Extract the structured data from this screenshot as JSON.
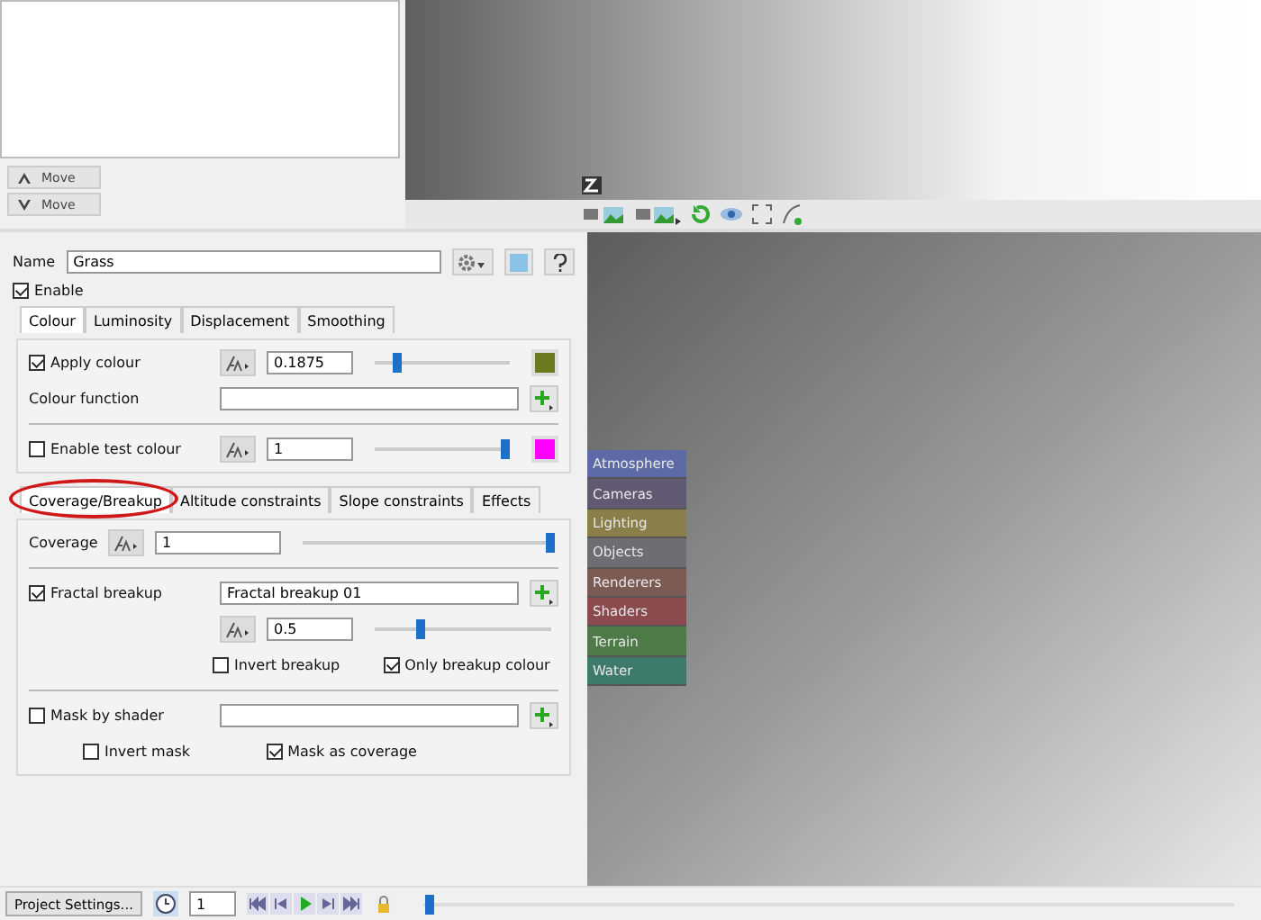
{
  "move_buttons": [
    {
      "label": "Move",
      "kind": "up"
    },
    {
      "label": "Move",
      "kind": "down"
    }
  ],
  "node_palette": [
    {
      "label": "Atmosphere",
      "color": "#5d6aa6"
    },
    {
      "label": "Cameras",
      "color": "#5f5a72"
    },
    {
      "label": "Lighting",
      "color": "#8a7e4a"
    },
    {
      "label": "Objects",
      "color": "#6e6e72"
    },
    {
      "label": "Renderers",
      "color": "#7a5a52"
    },
    {
      "label": "Shaders",
      "color": "#8a4a4e"
    },
    {
      "label": "Terrain",
      "color": "#4e7a48"
    },
    {
      "label": "Water",
      "color": "#3e7a6a"
    }
  ],
  "name_field": {
    "label": "Name",
    "value": "Grass"
  },
  "enable": {
    "label": "Enable",
    "checked": true
  },
  "colour_tabs": [
    {
      "label": "Colour",
      "selected": true
    },
    {
      "label": "Luminosity",
      "selected": false
    },
    {
      "label": "Displacement",
      "selected": false
    },
    {
      "label": "Smoothing",
      "selected": false
    }
  ],
  "apply_colour": {
    "label": "Apply colour",
    "checked": true,
    "value": "0.1875",
    "level": 0.17,
    "color": "#6b7a1e"
  },
  "colour_function": {
    "label": "Colour function"
  },
  "test_colour": {
    "label": "Enable test colour",
    "checked": false,
    "value": "1",
    "level": 0.97,
    "color": "#ff00ff"
  },
  "coverage_tabs": [
    {
      "label": "Coverage/Breakup",
      "selected": true,
      "circled": true
    },
    {
      "label": "Altitude constraints",
      "selected": false,
      "circled": false
    },
    {
      "label": "Slope constraints",
      "selected": false,
      "circled": false
    },
    {
      "label": "Effects",
      "selected": false,
      "circled": false
    }
  ],
  "coverage": {
    "label": "Coverage",
    "value": "1",
    "level": 1
  },
  "fractal": {
    "label": "Fractal breakup",
    "checked": true,
    "shader": "Fractal breakup 01",
    "value": "0.5",
    "level": 0.27
  },
  "invert_breakup": {
    "label": "Invert breakup",
    "checked": false
  },
  "only_breakup_colour": {
    "label": "Only breakup colour",
    "checked": true
  },
  "mask": {
    "label": "Mask by shader",
    "checked": false
  },
  "invert_mask": {
    "label": "Invert mask",
    "checked": false
  },
  "mask_as_coverage": {
    "label": "Mask as coverage",
    "checked": true
  },
  "bottom_bar": {
    "settings_button": "Project Settings...",
    "frame": "1",
    "level": 0.01
  }
}
